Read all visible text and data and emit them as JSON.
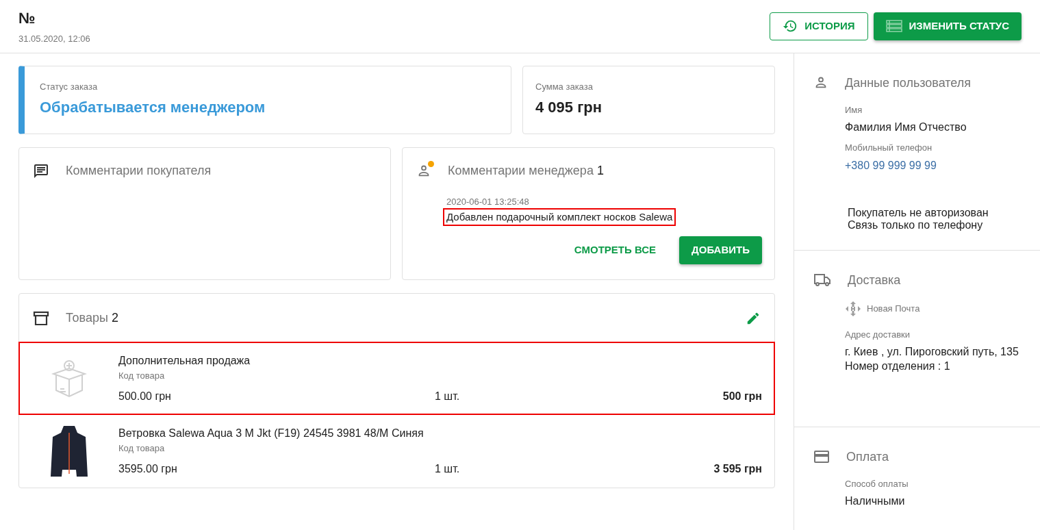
{
  "header": {
    "title": "№",
    "date": "31.05.2020, 12:06",
    "buttons": [
      {
        "kind": "outline",
        "label": "ИСТОРИЯ"
      },
      {
        "kind": "solid",
        "label": "ИЗМЕНИТЬ СТАТУС"
      }
    ]
  },
  "status": {
    "label": "Статус заказа",
    "value": "Обрабатывается менеджером"
  },
  "total": {
    "label": "Сумма заказа",
    "value": "4 095 грн"
  },
  "buyer_comments": {
    "title": "Комментарии покупателя"
  },
  "manager_comments": {
    "title": "Комментарии менеджера",
    "count": "1",
    "unread": true,
    "comments": [
      {
        "date": "2020-06-01 13:25:48",
        "text": "Добавлен подарочный комплект носков Salewa",
        "highlighted": true
      }
    ],
    "buttons": [
      {
        "kind": "text",
        "label": "СМОТРЕТЬ ВСЕ"
      },
      {
        "kind": "solid",
        "label": "ДОБАВИТЬ"
      }
    ]
  },
  "products": {
    "title": "Товары",
    "count": "2",
    "items": [
      {
        "kind": "box",
        "name": "Дополнительная продажа",
        "code_label": "Код товара",
        "price": "500.00 грн",
        "qty": "1 шт.",
        "sum": "500 грн",
        "highlighted": true
      },
      {
        "kind": "photo",
        "name": "Ветровка Salewa Aqua 3 M Jkt (F19) 24545 3981 48/M Синяя",
        "code_label": "Код товара",
        "price": "3595.00 грн",
        "qty": "1 шт.",
        "sum": "3 595 грн",
        "highlighted": false
      }
    ]
  },
  "sidebar": [
    {
      "kind": "user",
      "title": "Данные пользователя",
      "fields": [
        {
          "label": "Имя",
          "value": "Фамилия Имя Отчество",
          "link": false
        },
        {
          "label": "Мобильный телефон",
          "value": "+380 99 999 99 99",
          "link": true
        }
      ],
      "note": [
        "Покупатель не авторизован",
        "Связь только по телефону"
      ]
    },
    {
      "kind": "delivery",
      "title": "Доставка",
      "carrier": "Новая Почта",
      "fields": [
        {
          "label": "Адрес доставки",
          "value": "г. Киев , ул. Пироговский путь, 135",
          "link": false
        }
      ],
      "note": [
        "Номер отделения : 1"
      ]
    },
    {
      "kind": "payment",
      "title": "Оплата",
      "fields": [
        {
          "label": "Способ оплаты",
          "value": "Наличными",
          "link": false
        }
      ]
    }
  ]
}
